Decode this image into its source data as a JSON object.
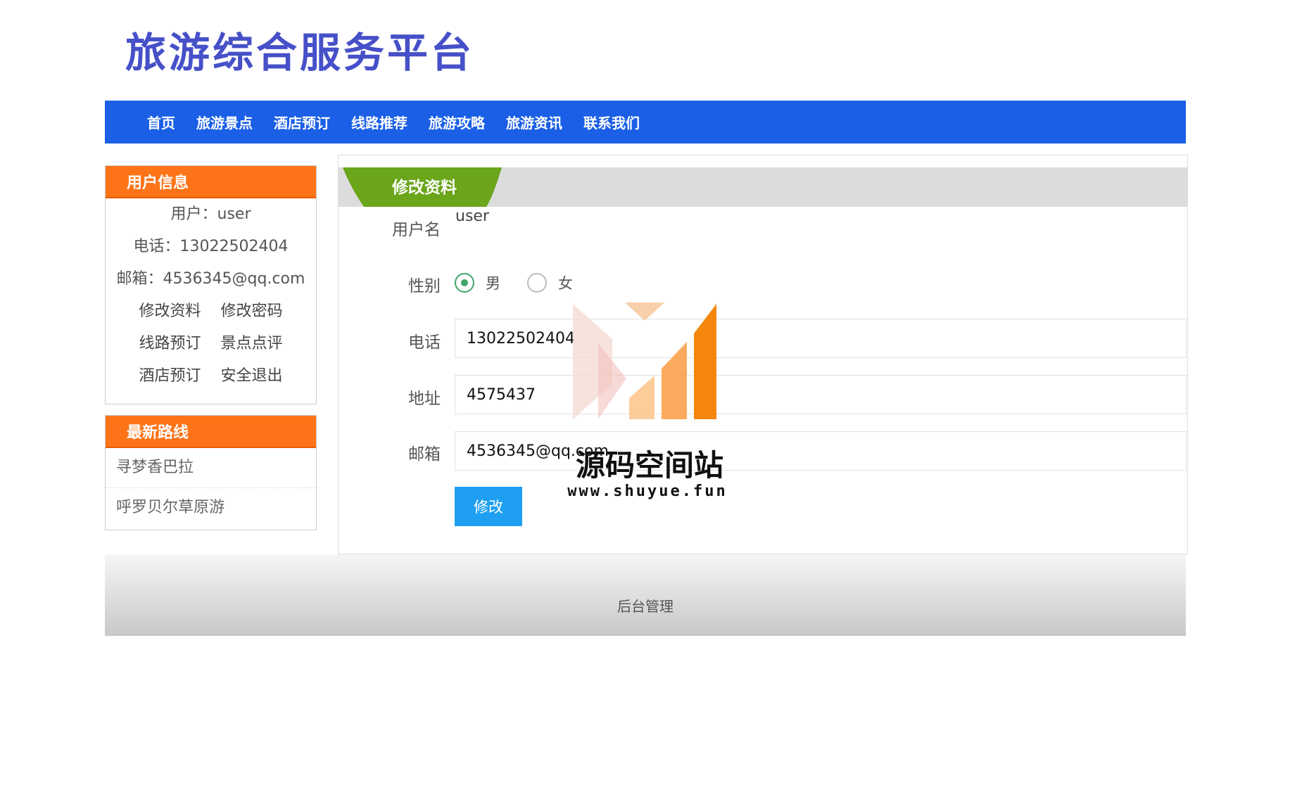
{
  "site": {
    "title": "旅游综合服务平台"
  },
  "nav": {
    "items": [
      "首页",
      "旅游景点",
      "酒店预订",
      "线路推荐",
      "旅游攻略",
      "旅游资讯",
      "联系我们"
    ]
  },
  "user_info": {
    "heading": "用户信息",
    "user_line": "用户：user",
    "phone_line": "电话：13022502404",
    "email_line": "邮箱：4536345@qq.com",
    "links": [
      "修改资料",
      "修改密码",
      "线路预订",
      "景点点评",
      "酒店预订",
      "安全退出"
    ]
  },
  "latest_routes": {
    "heading": "最新路线",
    "items": [
      "寻梦香巴拉",
      "呼罗贝尔草原游"
    ]
  },
  "form": {
    "tab_title": "修改资料",
    "username_label": "用户名",
    "username_value": "user",
    "gender_label": "性别",
    "gender_options": [
      "男",
      "女"
    ],
    "gender_selected": "男",
    "phone_label": "电话",
    "phone_value": "13022502404",
    "address_label": "地址",
    "address_value": "4575437",
    "email_label": "邮箱",
    "email_value": "4536345@qq.com",
    "submit_label": "修改"
  },
  "footer": {
    "admin_link": "后台管理"
  },
  "watermark": {
    "text": "源码空间站",
    "url": "www.shuyue.fun"
  },
  "colors": {
    "title": "#4650c8",
    "nav_bg": "#1a5fe6",
    "side_head": "#fd7418",
    "tab_green": "#6aa51a",
    "radio_checked": "#3fa46a",
    "button": "#1e9ff2"
  }
}
